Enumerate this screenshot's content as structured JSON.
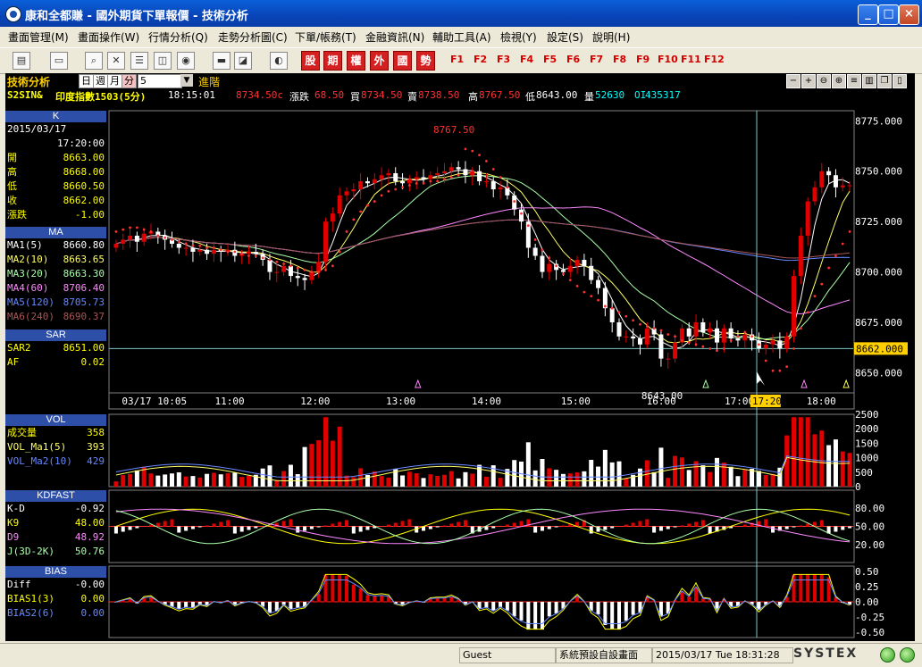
{
  "window": {
    "title": "康和全都賺 - 國外期貨下單報價 - 技術分析",
    "min": "_",
    "max": "□",
    "close": "×"
  },
  "menu": [
    "畫面管理(M)",
    "畫面操作(W)",
    "行情分析(Q)",
    "走勢分析圖(C)",
    "下單/帳務(T)",
    "金融資訊(N)",
    "輔助工具(A)",
    "檢視(Y)",
    "設定(S)",
    "說明(H)"
  ],
  "toolbar": {
    "red_buttons": [
      "股",
      "期",
      "權",
      "外",
      "國",
      "勢"
    ],
    "fkeys": [
      "F1",
      "F2",
      "F3",
      "F4",
      "F5",
      "F6",
      "F7",
      "F8",
      "F9",
      "F10",
      "F11",
      "F12"
    ]
  },
  "chart_header": {
    "title": "技術分析",
    "period_options": [
      "日",
      "週",
      "月",
      "分"
    ],
    "period_selected": "分",
    "interval": "5",
    "advanced_label": "進階",
    "symbol": "S2SIN&",
    "symbol_name": "印度指數1503(5分)",
    "time": "18:15:01",
    "last": "8734.50c",
    "change_label": "漲跌",
    "change": "68.50",
    "bid_label": "買",
    "bid": "8734.50",
    "ask_label": "賣",
    "ask": "8738.50",
    "high_label": "高",
    "high": "8767.50",
    "low_label": "低",
    "low": "8643.00",
    "vol_label": "量",
    "vol": "52630",
    "oi_label": "OI",
    "oi": "435317"
  },
  "k_panel": {
    "title": "K",
    "date": "2015/03/17",
    "time": "17:20:00",
    "rows": [
      {
        "label": "開",
        "value": "8663.00"
      },
      {
        "label": "高",
        "value": "8668.00"
      },
      {
        "label": "低",
        "value": "8660.50"
      },
      {
        "label": "收",
        "value": "8662.00"
      },
      {
        "label": "漲跌",
        "value": "-1.00"
      }
    ]
  },
  "ma_panel": {
    "title": "MA",
    "rows": [
      {
        "label": "MA1(5)",
        "value": "8660.80",
        "color": "#ffffff"
      },
      {
        "label": "MA2(10)",
        "value": "8663.65",
        "color": "#ffff66"
      },
      {
        "label": "MA3(20)",
        "value": "8663.30",
        "color": "#aaffaa"
      },
      {
        "label": "MA4(60)",
        "value": "8706.40",
        "color": "#ff88ff"
      },
      {
        "label": "MA5(120)",
        "value": "8705.73",
        "color": "#6688ff"
      },
      {
        "label": "MA6(240)",
        "value": "8690.37",
        "color": "#aa5555"
      }
    ]
  },
  "sar_panel": {
    "title": "SAR",
    "rows": [
      {
        "label": "SAR2",
        "value": "8651.00"
      },
      {
        "label": "AF",
        "value": "0.02"
      }
    ]
  },
  "vol_panel": {
    "title": "VOL",
    "rows": [
      {
        "label": "成交量",
        "value": "358"
      },
      {
        "label": "VOL_Ma1(5)",
        "value": "393"
      },
      {
        "label": "VOL_Ma2(10)",
        "value": "429"
      }
    ]
  },
  "kd_panel": {
    "title": "KDFAST",
    "rows": [
      {
        "label": "K-D",
        "value": "-0.92"
      },
      {
        "label": "K9",
        "value": "48.00"
      },
      {
        "label": "D9",
        "value": "48.92"
      },
      {
        "label": "J(3D-2K)",
        "value": "50.76"
      }
    ]
  },
  "bias_panel": {
    "title": "BIAS",
    "rows": [
      {
        "label": "Diff",
        "value": "-0.00"
      },
      {
        "label": "BIAS1(3)",
        "value": "0.00"
      },
      {
        "label": "BIAS2(6)",
        "value": "0.00"
      }
    ]
  },
  "price_axis": [
    "8775.000",
    "8750.000",
    "8725.000",
    "8700.000",
    "8675.000",
    "8662.000",
    "8650.000"
  ],
  "vol_axis": [
    "2500",
    "2000",
    "1500",
    "1000",
    "500",
    "0"
  ],
  "kd_axis": [
    "80.00",
    "50.00",
    "20.00"
  ],
  "bias_axis": [
    "0.50",
    "0.25",
    "0.00",
    "-0.25",
    "-0.50"
  ],
  "time_axis": [
    "03/17 10:05",
    "11:00",
    "12:00",
    "13:00",
    "14:00",
    "15:00",
    "16:00",
    "17:00",
    "17:20",
    "18:00"
  ],
  "annotations": {
    "high": "8767.50",
    "low": "8643.00"
  },
  "status": {
    "user": "Guest",
    "mode": "系統預設自設畫面",
    "datetime": "2015/03/17 Tue 18:31:28",
    "brand": "SYSTEX"
  },
  "colors": {
    "up": "#e00000",
    "down": "#ffffff",
    "sar": "#ff3030",
    "cursor": "#7fc7c7",
    "highlight": "#ffd000"
  },
  "chart_data": {
    "type": "candlestick",
    "interval_minutes": 5,
    "close": [
      8714,
      8716,
      8718,
      8715,
      8719,
      8720,
      8718,
      8716,
      8714,
      8712,
      8712,
      8710,
      8711,
      8709,
      8711,
      8710,
      8711,
      8708,
      8709,
      8710,
      8709,
      8706,
      8700,
      8700,
      8703,
      8698,
      8697,
      8696,
      8700,
      8705,
      8725,
      8729,
      8738,
      8740,
      8741,
      8745,
      8744,
      8746,
      8748,
      8749,
      8745,
      8744,
      8746,
      8747,
      8746,
      8748,
      8749,
      8750,
      8752,
      8751,
      8748,
      8750,
      8745,
      8745,
      8741,
      8742,
      8738,
      8731,
      8725,
      8712,
      8708,
      8700,
      8704,
      8701,
      8700,
      8703,
      8706,
      8703,
      8696,
      8692,
      8682,
      8675,
      8668,
      8668,
      8667,
      8664,
      8672,
      8669,
      8657,
      8657,
      8665,
      8672,
      8668,
      8675,
      8670,
      8672,
      8665,
      8672,
      8667,
      8666,
      8669,
      8666,
      8662,
      8664,
      8666,
      8662,
      8668,
      8698,
      8718,
      8735,
      8742,
      8750,
      8748,
      8742,
      8743,
      8743
    ],
    "sar": [
      8720,
      8721,
      8722,
      8722,
      8721,
      8720,
      8718,
      8717,
      8716,
      8715,
      8714,
      8713,
      8713,
      8712,
      8712,
      8711,
      8710,
      8710,
      8709,
      8708,
      8708,
      8707,
      8706,
      8705,
      8704,
      8703,
      8702,
      8701,
      8700,
      8700,
      8701,
      8703,
      8710,
      8720,
      8726,
      8730,
      8733,
      8735,
      8738,
      8740,
      8741,
      8742,
      8743,
      8744,
      8744,
      8745,
      8745,
      8746,
      8747,
      8748,
      8761,
      8760,
      8758,
      8755,
      8751,
      8747,
      8742,
      8735,
      8729,
      8723,
      8716,
      8711,
      8707,
      8703,
      8699,
      8696,
      8693,
      8690,
      8688,
      8686,
      8683,
      8682,
      8680,
      8678,
      8676,
      8674,
      8673,
      8672,
      8671,
      8669,
      8668,
      8666,
      8665,
      8664,
      8663,
      8662,
      8661,
      8662,
      8666,
      8668,
      8670,
      8668,
      8664,
      8656,
      8651,
      8651,
      8653,
      8662,
      8672,
      8680,
      8688,
      8694,
      8702,
      8708,
      8714,
      8720
    ],
    "sar_last": 8651.0,
    "high": 8767.5,
    "low": 8643.0,
    "ma": {
      "ma5": 8660.8,
      "ma10": 8663.65,
      "ma20": 8663.3,
      "ma60": 8706.4,
      "ma120": 8705.73,
      "ma240": 8690.37
    },
    "last_bar": {
      "date": "2015/03/17",
      "time": "17:20:00",
      "open": 8663.0,
      "high": 8668.0,
      "low": 8660.5,
      "close": 8662.0,
      "change": -1.0
    },
    "volume_last": 358,
    "kd": {
      "k9": 48.0,
      "d9": 48.92,
      "j": 50.76
    },
    "ylim": [
      8640,
      8780
    ]
  }
}
